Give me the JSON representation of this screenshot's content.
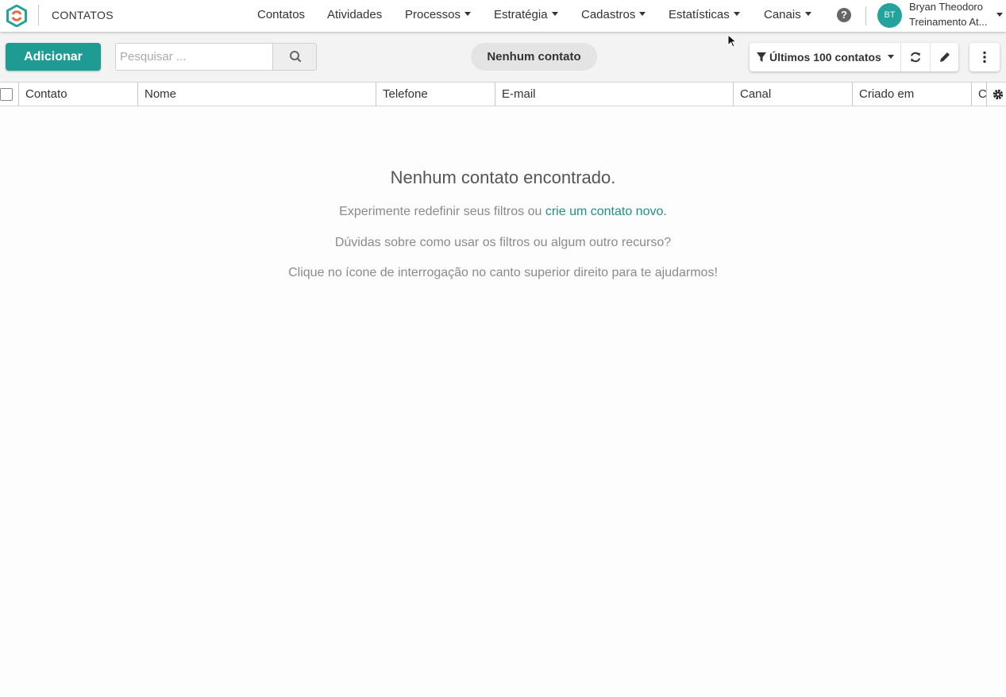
{
  "app": {
    "title": "CONTATOS"
  },
  "nav": [
    {
      "label": "Contatos",
      "dropdown": false
    },
    {
      "label": "Atividades",
      "dropdown": false
    },
    {
      "label": "Processos",
      "dropdown": true
    },
    {
      "label": "Estratégia",
      "dropdown": true
    },
    {
      "label": "Cadastros",
      "dropdown": true
    },
    {
      "label": "Estatísticas",
      "dropdown": true
    },
    {
      "label": "Canais",
      "dropdown": true
    }
  ],
  "help": {
    "icon": "question-circle-icon",
    "glyph": "?"
  },
  "user": {
    "initials": "BT",
    "name": "Bryan Theodoro",
    "org": "Treinamento At..."
  },
  "toolbar": {
    "add_label": "Adicionar",
    "search_placeholder": "Pesquisar ...",
    "count_label": "Nenhum contato",
    "filter_label": "Últimos 100 contatos"
  },
  "table": {
    "columns": [
      "Contato",
      "Nome",
      "Telefone",
      "E-mail",
      "Canal",
      "Criado em",
      "C"
    ]
  },
  "empty_state": {
    "title": "Nenhum contato encontrado.",
    "line1_prefix": "Experimente redefinir seus filtros ou ",
    "line1_link": "crie um contato novo",
    "line1_suffix": ".",
    "line2": "Dúvidas sobre como usar os filtros ou algum outro recurso?",
    "line3": "Clique no ícone de interrogação no canto superior direito para te ajudarmos!"
  },
  "colors": {
    "accent": "#1e9c94",
    "avatar": "#24a39c",
    "link": "#1e8f89"
  }
}
